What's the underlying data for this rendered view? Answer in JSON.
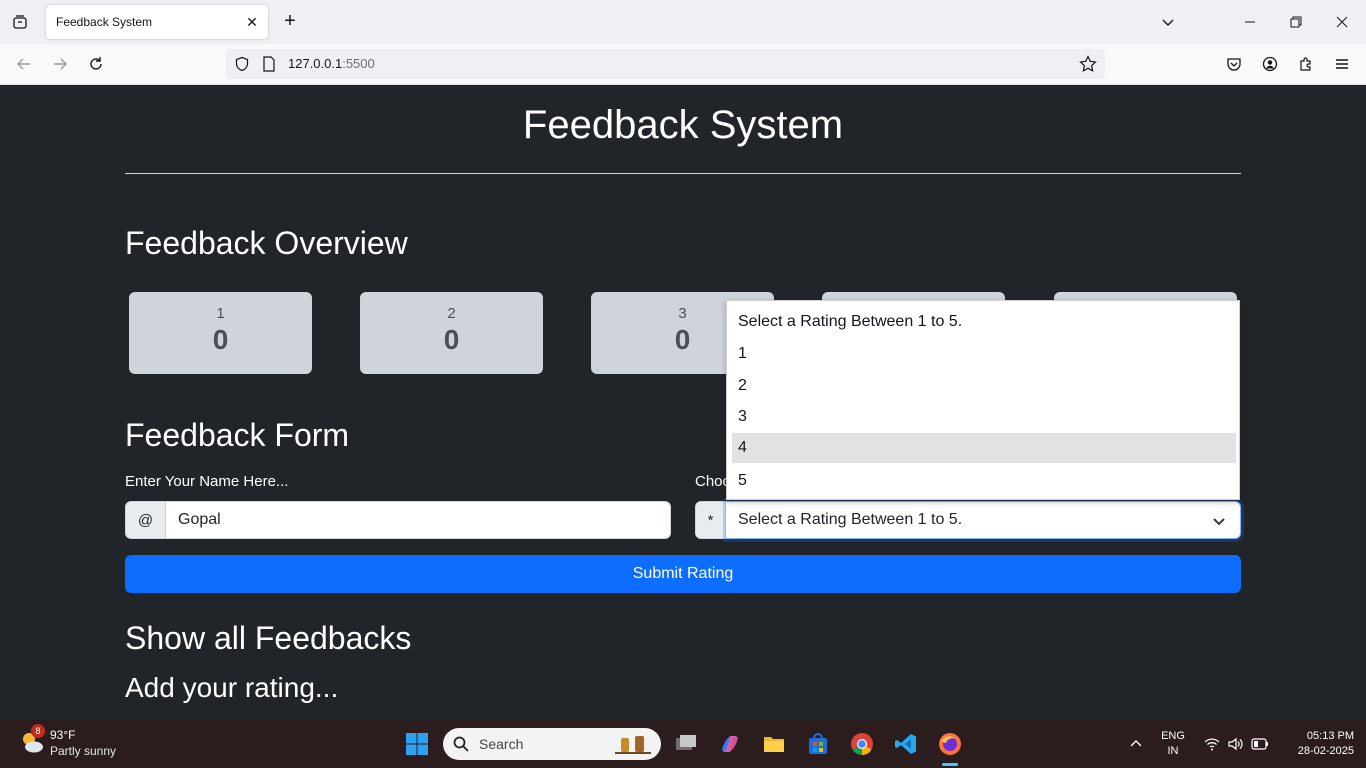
{
  "browser": {
    "tab_title": "Feedback System",
    "url_host": "127.0.0.1",
    "url_port": ":5500"
  },
  "page": {
    "title": "Feedback System",
    "overview_heading": "Feedback Overview",
    "cards": [
      {
        "label": "1",
        "count": "0"
      },
      {
        "label": "2",
        "count": "0"
      },
      {
        "label": "3",
        "count": "0"
      },
      {
        "label": "",
        "count": ""
      },
      {
        "label": "",
        "count": ""
      }
    ],
    "form_heading": "Feedback Form",
    "name_label": "Enter Your Name Here...",
    "name_addon": "@",
    "name_value": "Gopal",
    "rating_label": "Choc",
    "rating_addon": "*",
    "rating_selected": "Select a Rating Between 1 to 5.",
    "rating_options": [
      "Select a Rating Between 1 to 5.",
      "1",
      "2",
      "3",
      "4",
      "5"
    ],
    "highlighted_option": "4",
    "submit_label": "Submit Rating",
    "show_all_heading": "Show all Feedbacks",
    "add_rating_heading": "Add your rating..."
  },
  "taskbar": {
    "weather_badge": "8",
    "weather_temp": "93°F",
    "weather_desc": "Partly sunny",
    "search_placeholder": "Search",
    "lang_line1": "ENG",
    "lang_line2": "IN",
    "time": "05:13 PM",
    "date": "28-02-2025"
  }
}
